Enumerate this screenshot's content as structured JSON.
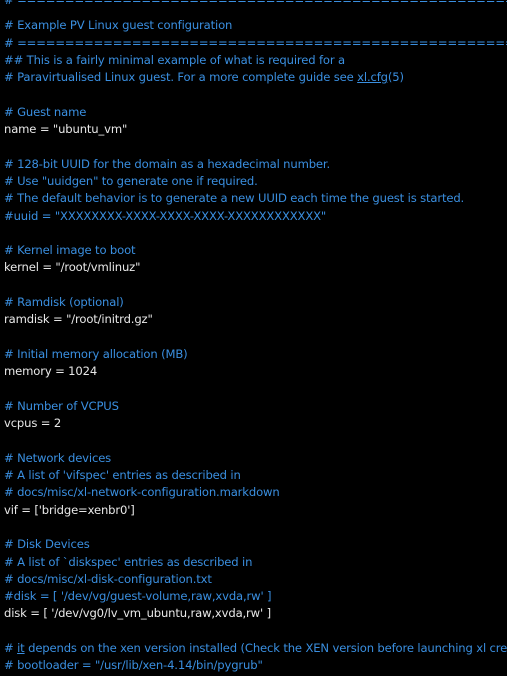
{
  "editor": {
    "lines": [
      {
        "type": "comment",
        "text": "# ================================================================"
      },
      {
        "type": "comment",
        "text": "# Example PV Linux guest configuration"
      },
      {
        "type": "comment",
        "text": "# ================================================================"
      },
      {
        "type": "comment-link",
        "before": "## This is a fairly minimal example of what is required for a",
        "link": "",
        "after": ""
      },
      {
        "type": "comment-link",
        "before": "# Paravirtualised Linux guest. For a more complete guide see ",
        "link": "xl.cfg",
        "after": "(5)"
      },
      {
        "type": "blank",
        "text": ""
      },
      {
        "type": "comment",
        "text": "# Guest name"
      },
      {
        "type": "code",
        "text": "name = \"ubuntu_vm\""
      },
      {
        "type": "blank",
        "text": ""
      },
      {
        "type": "comment",
        "text": "# 128-bit UUID for the domain as a hexadecimal number."
      },
      {
        "type": "comment",
        "text": "# Use \"uuidgen\" to generate one if required."
      },
      {
        "type": "comment",
        "text": "# The default behavior is to generate a new UUID each time the guest is started."
      },
      {
        "type": "comment",
        "text": "#uuid = \"XXXXXXXX-XXXX-XXXX-XXXX-XXXXXXXXXXXX\""
      },
      {
        "type": "blank",
        "text": ""
      },
      {
        "type": "comment",
        "text": "# Kernel image to boot"
      },
      {
        "type": "code",
        "text": "kernel = \"/root/vmlinuz\""
      },
      {
        "type": "blank",
        "text": ""
      },
      {
        "type": "comment",
        "text": "# Ramdisk (optional)"
      },
      {
        "type": "code",
        "text": "ramdisk = \"/root/initrd.gz\""
      },
      {
        "type": "blank",
        "text": ""
      },
      {
        "type": "comment",
        "text": "# Initial memory allocation (MB)"
      },
      {
        "type": "code",
        "text": "memory = 1024"
      },
      {
        "type": "blank",
        "text": ""
      },
      {
        "type": "comment",
        "text": "# Number of VCPUS"
      },
      {
        "type": "code",
        "text": "vcpus = 2"
      },
      {
        "type": "blank",
        "text": ""
      },
      {
        "type": "comment",
        "text": "# Network devices"
      },
      {
        "type": "comment",
        "text": "# A list of 'vifspec' entries as described in"
      },
      {
        "type": "comment",
        "text": "# docs/misc/xl-network-configuration.markdown"
      },
      {
        "type": "code",
        "text": "vif = ['bridge=xenbr0']"
      },
      {
        "type": "blank",
        "text": ""
      },
      {
        "type": "comment",
        "text": "# Disk Devices"
      },
      {
        "type": "comment",
        "text": "# A list of `diskspec' entries as described in"
      },
      {
        "type": "comment",
        "text": "# docs/misc/xl-disk-configuration.txt"
      },
      {
        "type": "comment",
        "text": "#disk = [ '/dev/vg/guest-volume,raw,xvda,rw' ]"
      },
      {
        "type": "code",
        "text": "disk = [ '/dev/vg0/lv_vm_ubuntu,raw,xvda,rw' ]"
      },
      {
        "type": "blank",
        "text": ""
      },
      {
        "type": "comment-link",
        "before": "# ",
        "link": "it",
        "after": " depends on the xen version installed (Check the XEN version before launching xl create)"
      },
      {
        "type": "comment",
        "text": "# bootloader = \"/usr/lib/xen-4.14/bin/pygrub\""
      }
    ]
  },
  "colors": {
    "background": "#000000",
    "comment": "#3a8fe0",
    "code": "#e8e8e8"
  }
}
